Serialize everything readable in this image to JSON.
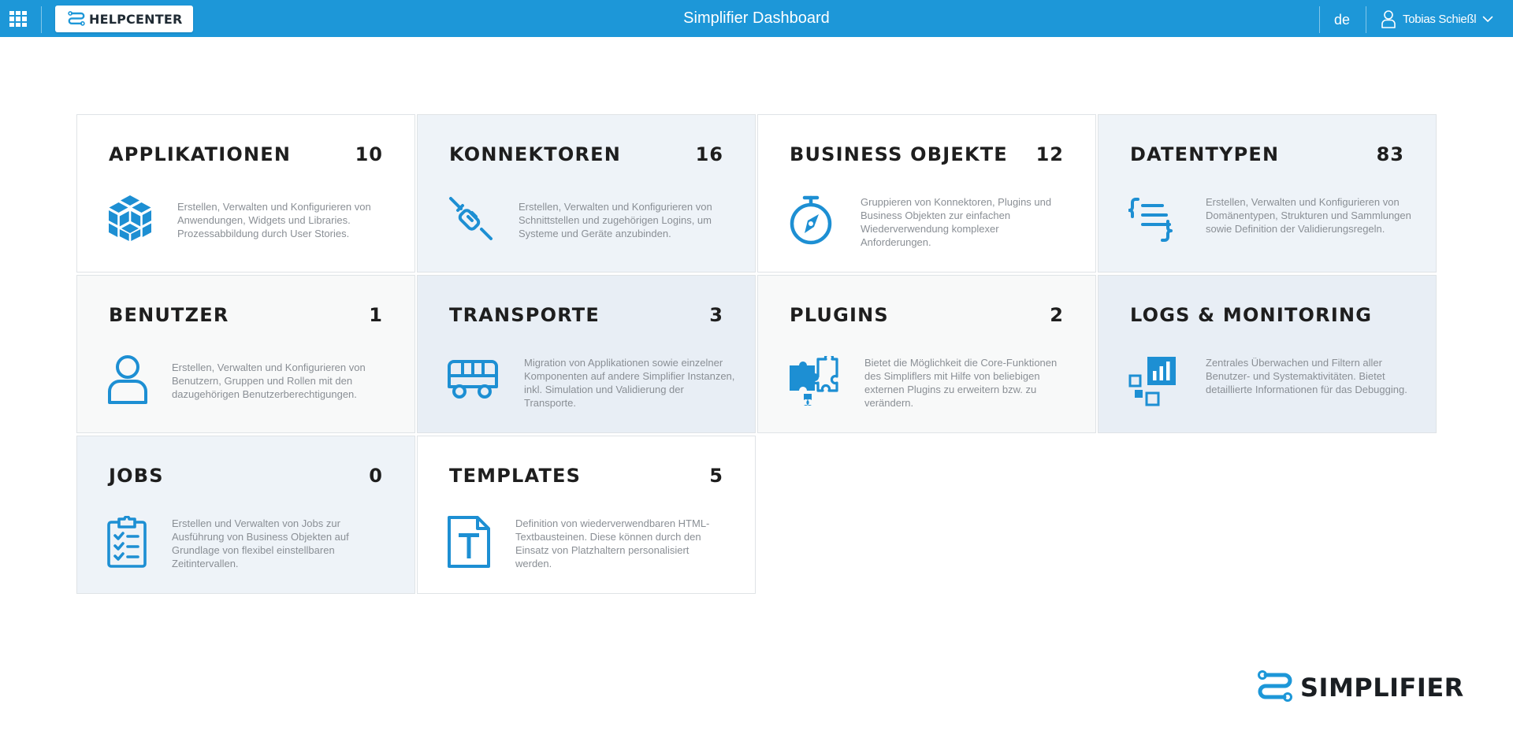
{
  "header": {
    "help_label": "HELPCENTER",
    "title": "Simplifier Dashboard",
    "language": "de",
    "user_name": "Tobias Schießl"
  },
  "tiles": [
    {
      "title": "APPLIKATIONEN",
      "count": "10",
      "icon": "cube-icon",
      "desc": "Erstellen, Verwalten und Konfigurieren von Anwendungen, Widgets und Libraries. Prozessabbildung durch User Stories."
    },
    {
      "title": "KONNEKTOREN",
      "count": "16",
      "icon": "plug-icon",
      "desc": "Erstellen, Verwalten und Konfigurieren von Schnittstellen und zugehörigen Logins, um Systeme und Geräte anzubinden."
    },
    {
      "title": "BUSINESS OBJEKTE",
      "count": "12",
      "icon": "stopwatch-compass-icon",
      "desc": "Gruppieren von Konnektoren, Plugins und Business Objekten zur einfachen Wiederverwendung komplexer Anforderungen."
    },
    {
      "title": "DATENTYPEN",
      "count": "83",
      "icon": "braces-list-icon",
      "desc": "Erstellen, Verwalten und Konfigurieren von Domänentypen, Strukturen und Sammlungen sowie Definition der Validierungsregeln."
    },
    {
      "title": "BENUTZER",
      "count": "1",
      "icon": "user-icon",
      "desc": "Erstellen, Verwalten und Konfigurieren von Benutzern, Gruppen und Rollen mit den dazugehörigen Benutzerberechtigungen."
    },
    {
      "title": "TRANSPORTE",
      "count": "3",
      "icon": "bus-icon",
      "desc": "Migration von Applikationen sowie einzelner Komponenten auf andere Simplifier Instanzen, inkl. Simulation und Validierung der Transporte."
    },
    {
      "title": "PLUGINS",
      "count": "2",
      "icon": "puzzle-icon",
      "desc": "Bietet die Möglichkeit die Core-Funktionen des Simpliflers mit Hilfe von beliebigen externen Plugins zu erweitern bzw. zu verändern."
    },
    {
      "title": "LOGS & MONITORING",
      "count": "",
      "icon": "monitoring-chart-icon",
      "desc": "Zentrales Überwachen und Filtern aller Benutzer- und Systemaktivitäten. Bietet detaillierte Informationen für das Debugging."
    },
    {
      "title": "JOBS",
      "count": "0",
      "icon": "clipboard-checklist-icon",
      "desc": "Erstellen und Verwalten von Jobs zur Ausführung von Business Objekten auf Grundlage von flexibel einstellbaren Zeitintervallen."
    },
    {
      "title": "TEMPLATES",
      "count": "5",
      "icon": "text-document-icon",
      "desc": "Definition von wiederverwendbaren HTML-Textbausteinen. Diese können durch den Einsatz von Platzhaltern personalisiert werden."
    }
  ],
  "footer": {
    "brand": "SIMPLIFIER"
  },
  "colors": {
    "accent": "#1d97d8",
    "icon": "#1d8fd3",
    "title_text": "#1e1e1e",
    "desc_text": "#8a8f95"
  }
}
